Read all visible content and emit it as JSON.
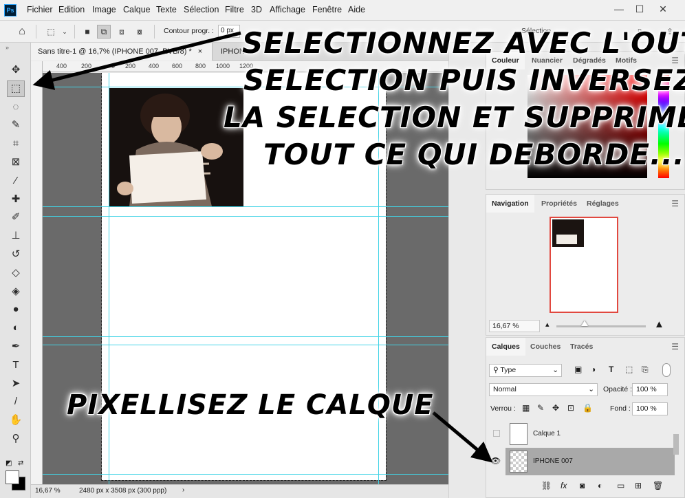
{
  "app": {
    "logo": "Ps",
    "menu": [
      "Fichier",
      "Edition",
      "Image",
      "Calque",
      "Texte",
      "Sélection",
      "Filtre",
      "3D",
      "Affichage",
      "Fenêtre",
      "Aide"
    ]
  },
  "options_bar": {
    "feather_label": "Contour progr. :",
    "feather_value": "0 px",
    "select_partial": "Sélection"
  },
  "tools": [
    {
      "name": "move-tool-icon",
      "glyph": "✥"
    },
    {
      "name": "marquee-tool-icon",
      "glyph": "⬚"
    },
    {
      "name": "lasso-tool-icon",
      "glyph": "◌"
    },
    {
      "name": "quick-select-tool-icon",
      "glyph": "✎"
    },
    {
      "name": "crop-tool-icon",
      "glyph": "⌗"
    },
    {
      "name": "frame-tool-icon",
      "glyph": "⊠"
    },
    {
      "name": "eyedropper-tool-icon",
      "glyph": "⁄"
    },
    {
      "name": "healing-tool-icon",
      "glyph": "✚"
    },
    {
      "name": "brush-tool-icon",
      "glyph": "✐"
    },
    {
      "name": "stamp-tool-icon",
      "glyph": "⊥"
    },
    {
      "name": "history-brush-tool-icon",
      "glyph": "↺"
    },
    {
      "name": "eraser-tool-icon",
      "glyph": "◇"
    },
    {
      "name": "bucket-tool-icon",
      "glyph": "◈"
    },
    {
      "name": "blur-tool-icon",
      "glyph": "●"
    },
    {
      "name": "dodge-tool-icon",
      "glyph": "◐"
    },
    {
      "name": "pen-tool-icon",
      "glyph": "✒"
    },
    {
      "name": "type-tool-icon",
      "glyph": "T"
    },
    {
      "name": "path-select-tool-icon",
      "glyph": "➤"
    },
    {
      "name": "line-tool-icon",
      "glyph": "/"
    },
    {
      "name": "hand-tool-icon",
      "glyph": "✋"
    },
    {
      "name": "zoom-tool-icon",
      "glyph": "⚲"
    }
  ],
  "document": {
    "tab_active": "Sans titre-1 @ 16,7% (IPHONE 007, RVB/8) *",
    "tab_other": "IPHONE",
    "ruler_labels": [
      "400",
      "200",
      "0",
      "200",
      "400",
      "600",
      "800",
      "1000",
      "1200"
    ],
    "status_zoom": "16,67 %",
    "status_info": "2480 px x 3508 px (300 ppp)"
  },
  "color_panel": {
    "tabs": [
      "Couleur",
      "Nuancier",
      "Dégradés",
      "Motifs"
    ]
  },
  "navigation_panel": {
    "tabs": [
      "Navigation",
      "Propriétés",
      "Réglages"
    ],
    "zoom": "16,67 %"
  },
  "layers_panel": {
    "tabs": [
      "Calques",
      "Couches",
      "Tracés"
    ],
    "filter_type": "Type",
    "blend_mode": "Normal",
    "opacity_label": "Opacité :",
    "opacity_value": "100 %",
    "lock_label": "Verrou :",
    "fill_label": "Fond :",
    "fill_value": "100 %",
    "layers": [
      {
        "name": "Calque 1",
        "visible": false,
        "selected": false
      },
      {
        "name": "IPHONE 007",
        "visible": true,
        "selected": true
      }
    ],
    "footer_icons": [
      "link-icon",
      "fx-icon",
      "mask-icon",
      "adjustment-icon",
      "group-icon",
      "new-layer-icon",
      "trash-icon"
    ]
  },
  "annotations": {
    "top_lines": [
      "SELECTIONNEZ AVEC L'OUTIL",
      "SELECTION PUIS INVERSEZ",
      "LA SELECTION ET SUPPRIMEZ",
      "TOUT CE QUI DEBORDE..."
    ],
    "bottom": "PIXELLISEZ LE CALQUE"
  }
}
